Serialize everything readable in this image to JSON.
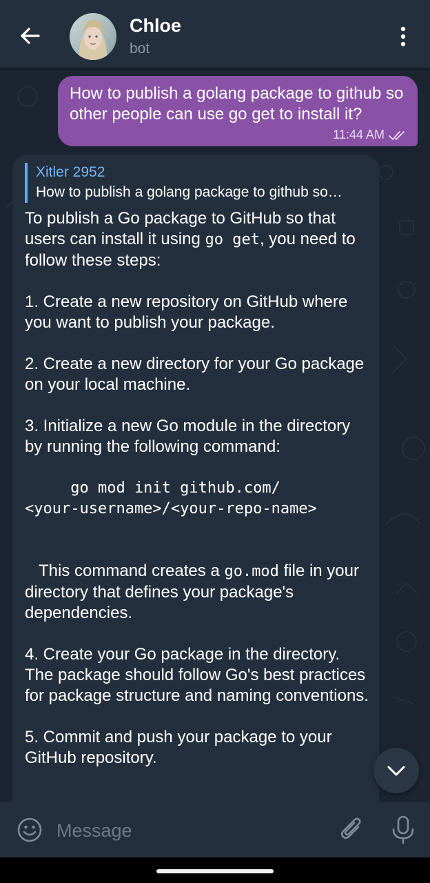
{
  "header": {
    "title": "Chloe",
    "subtitle": "bot",
    "back_icon": "arrow-left-icon",
    "menu_icon": "more-vertical-icon"
  },
  "messages": {
    "outgoing": {
      "text": "How to publish a golang package to github so other people can use go get to install it?",
      "time": "11:44 AM",
      "status_icon": "double-check-icon"
    },
    "incoming": {
      "reply_author": "Xitler 2952",
      "reply_text": "How to publish a golang package to github so…",
      "intro_before": "To publish a Go package to GitHub so that users can install it using ",
      "intro_code": "go get",
      "intro_after": ", you need to follow these steps:",
      "step1": "1. Create a new repository on GitHub where you want to publish your package.",
      "step2": "2. Create a new directory for your Go package on your local machine.",
      "step3": "3. Initialize a new Go module in the directory by running the following command:",
      "code_line1": "     go mod init github.com/",
      "code_line2": "<your-username>/<your-repo-name>",
      "note_before": "   This command creates a ",
      "note_code": "go.mod",
      "note_after": " file in your directory that defines your package's dependencies.",
      "step4": "4. Create your Go package in the directory. The package should follow Go's best practices for package structure and naming conventions.",
      "step5": "5. Commit and push your package to your GitHub repository."
    }
  },
  "composer": {
    "placeholder": "Message",
    "emoji_icon": "smiley-icon",
    "attach_icon": "paperclip-icon",
    "mic_icon": "microphone-icon"
  },
  "colors": {
    "background": "#1b2430",
    "header": "#242f3d",
    "outgoing_bubble": "#8a52a6",
    "incoming_bubble": "#242f3d",
    "accent": "#71b6f5"
  }
}
